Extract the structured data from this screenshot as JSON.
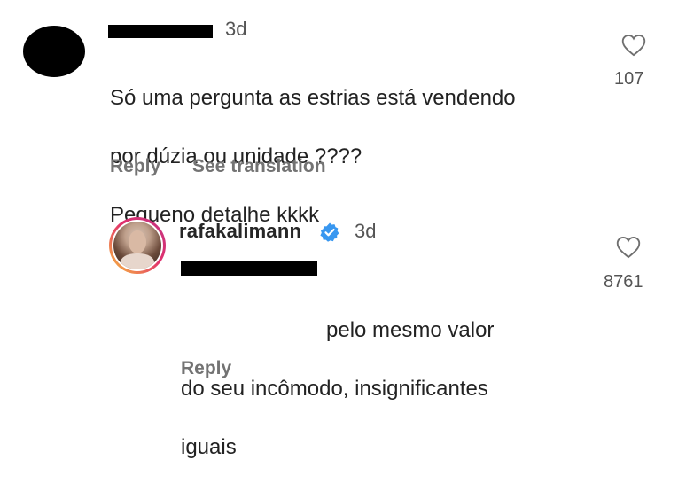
{
  "comment1": {
    "time": "3d",
    "lines": [
      "Só uma pergunta as estrias está vendendo",
      "por dúzia ou unidade ????",
      "Pequeno detalhe kkkk"
    ],
    "likes": "107",
    "reply_label": "Reply",
    "translate_label": "See translation"
  },
  "comment2": {
    "username": "rafakalimann",
    "verified_color": "#3897f0",
    "time": "3d",
    "line1_after_mention": "pelo mesmo valor",
    "lines": [
      "do seu incômodo, insignificantes",
      "iguais"
    ],
    "likes": "8761",
    "reply_label": "Reply"
  },
  "icons": {
    "like": "heart-outline-icon",
    "verified": "verified-badge-icon"
  }
}
